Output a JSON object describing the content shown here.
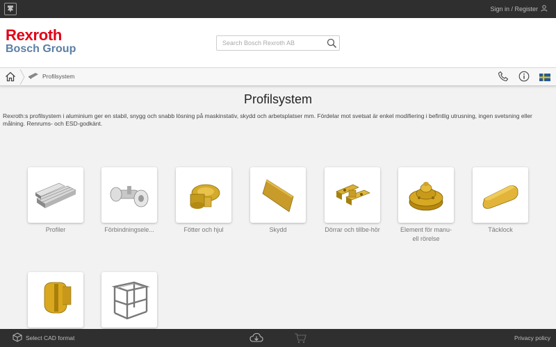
{
  "topbar": {
    "signin_label": "Sign in / Register"
  },
  "header": {
    "logo_line1": "Rexroth",
    "logo_line2": "Bosch Group",
    "search_placeholder": "Search Bosch Rexroth AB",
    "search_value": ""
  },
  "breadcrumb": {
    "current": "Profilsystem"
  },
  "main": {
    "title": "Profilsystem",
    "description": "Rexroth:s profilsystem i aluminium ger en stabil, snygg och snabb lösning på maskinstativ, skydd och arbetsplatser mm. Fördelar mot svetsat är enkel modifiering i befintlig utrusning, ingen svetsning eller målning. Renrums- och ESD-godkänt."
  },
  "categories": [
    {
      "label": "Profiler",
      "icon": "aluminium-profile-image"
    },
    {
      "label": "Förbindningsele...",
      "icon": "connector-image"
    },
    {
      "label": "Fötter och hjul",
      "icon": "foot-wheel-image"
    },
    {
      "label": "Skydd",
      "icon": "panel-image"
    },
    {
      "label": "Dörrar och tillbe-hör",
      "icon": "hinge-image"
    },
    {
      "label": "Element för manu-ell rörelse",
      "icon": "handwheel-image"
    },
    {
      "label": "Täcklock",
      "icon": "cap-image"
    },
    {
      "label": "",
      "icon": "knob-image"
    },
    {
      "label": "",
      "icon": "frame-image"
    }
  ],
  "bottombar": {
    "cad_label": "Select CAD format",
    "privacy_label": "Privacy policy"
  },
  "colors": {
    "brand_red": "#e20015",
    "brand_blue": "#5a7fa6",
    "bar_dark": "#2f2f2f",
    "gold": "#c9a227"
  }
}
